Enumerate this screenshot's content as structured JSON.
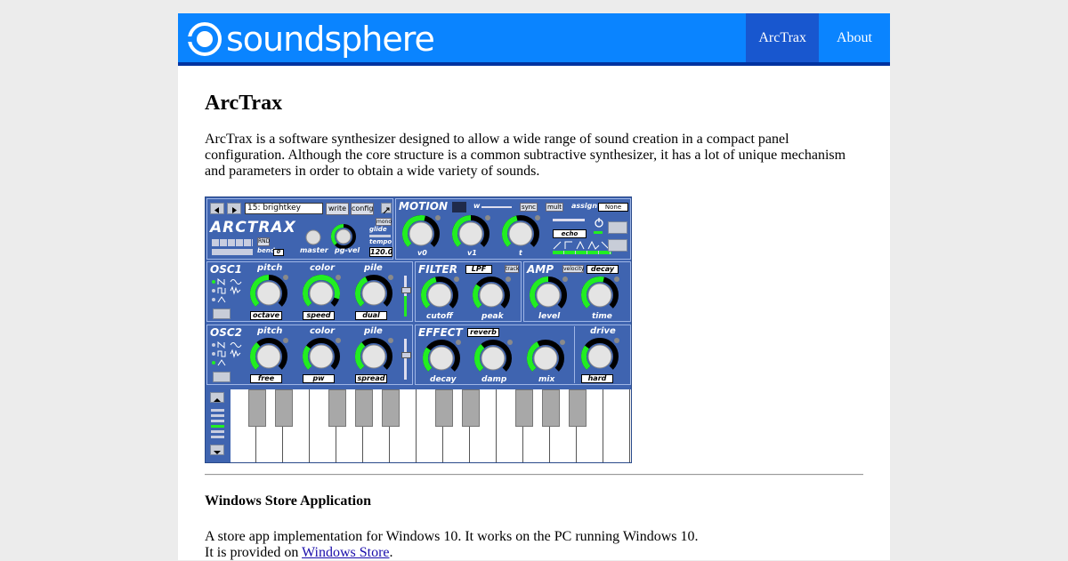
{
  "header": {
    "logo_text": "soundsphere",
    "nav": [
      {
        "label": "ArcTrax",
        "active": true
      },
      {
        "label": "About",
        "active": false
      }
    ]
  },
  "main": {
    "title": "ArcTrax",
    "intro": "ArcTrax is a software synthesizer designed to allow a wide range of sound creation in a compact panel configuration. Although the core structure is a common subtractive synthesizer, it has a lot of unique mechanism and parameters in order to obtain a wide variety of sounds.",
    "section_title": "Windows Store Application",
    "store_line1": "A store app implementation for Windows 10. It works on the PC running Windows 10.",
    "store_line2_prefix": "It is provided on ",
    "store_link": "Windows Store",
    "store_line2_suffix": "."
  },
  "synth": {
    "preset": "15: brightkey",
    "write": "write",
    "config": "config",
    "logo": "ARCTRAX",
    "rnd": "RND",
    "bend_label": "bend",
    "bend_value": "0",
    "mono": "mono",
    "glide": "glide",
    "tempo_label": "tempo",
    "tempo_value": "120.0",
    "master": "master",
    "pgvel": "pg-vel",
    "motion": {
      "title": "MOTION",
      "w": "w",
      "sync": "sync",
      "mult": "mult",
      "assign": "assign",
      "assign_value": "None",
      "v0": "v0",
      "v1": "v1",
      "t": "t",
      "echo": "echo",
      "levels": {
        "v0": 0.55,
        "v1": 0.5,
        "t": 0.45
      }
    },
    "osc1": {
      "title": "OSC1",
      "pitch": "pitch",
      "color": "color",
      "pile": "pile",
      "pitch_mode": "octave",
      "color_mode": "speed",
      "pile_mode": "dual",
      "levels": {
        "pitch": 0.5,
        "color": 0.9,
        "pile": 0.4
      }
    },
    "filter": {
      "title": "FILTER",
      "type": "LPF",
      "track": "track",
      "cutoff": "cutoff",
      "peak": "peak",
      "levels": {
        "cutoff": 0.45,
        "peak": 0.3
      }
    },
    "amp": {
      "title": "AMP",
      "velocity": "velocity",
      "decay": "decay",
      "level": "level",
      "time": "time",
      "levels": {
        "level": 0.5,
        "time": 0.55
      }
    },
    "osc2": {
      "title": "OSC2",
      "pitch": "pitch",
      "color": "color",
      "pile": "pile",
      "pitch_mode": "free",
      "color_mode": "pw",
      "pile_mode": "spread",
      "levels": {
        "pitch": 0.35,
        "color": 0.3,
        "pile": 0.35
      }
    },
    "effect": {
      "title": "EFFECT",
      "type": "reverb",
      "decay": "decay",
      "damp": "damp",
      "mix": "mix",
      "drive": "drive",
      "drive_mode": "hard",
      "levels": {
        "decay": 0.3,
        "damp": 0.35,
        "mix": 0.4,
        "drive": 0.3
      }
    },
    "accent": "#22ee22"
  }
}
